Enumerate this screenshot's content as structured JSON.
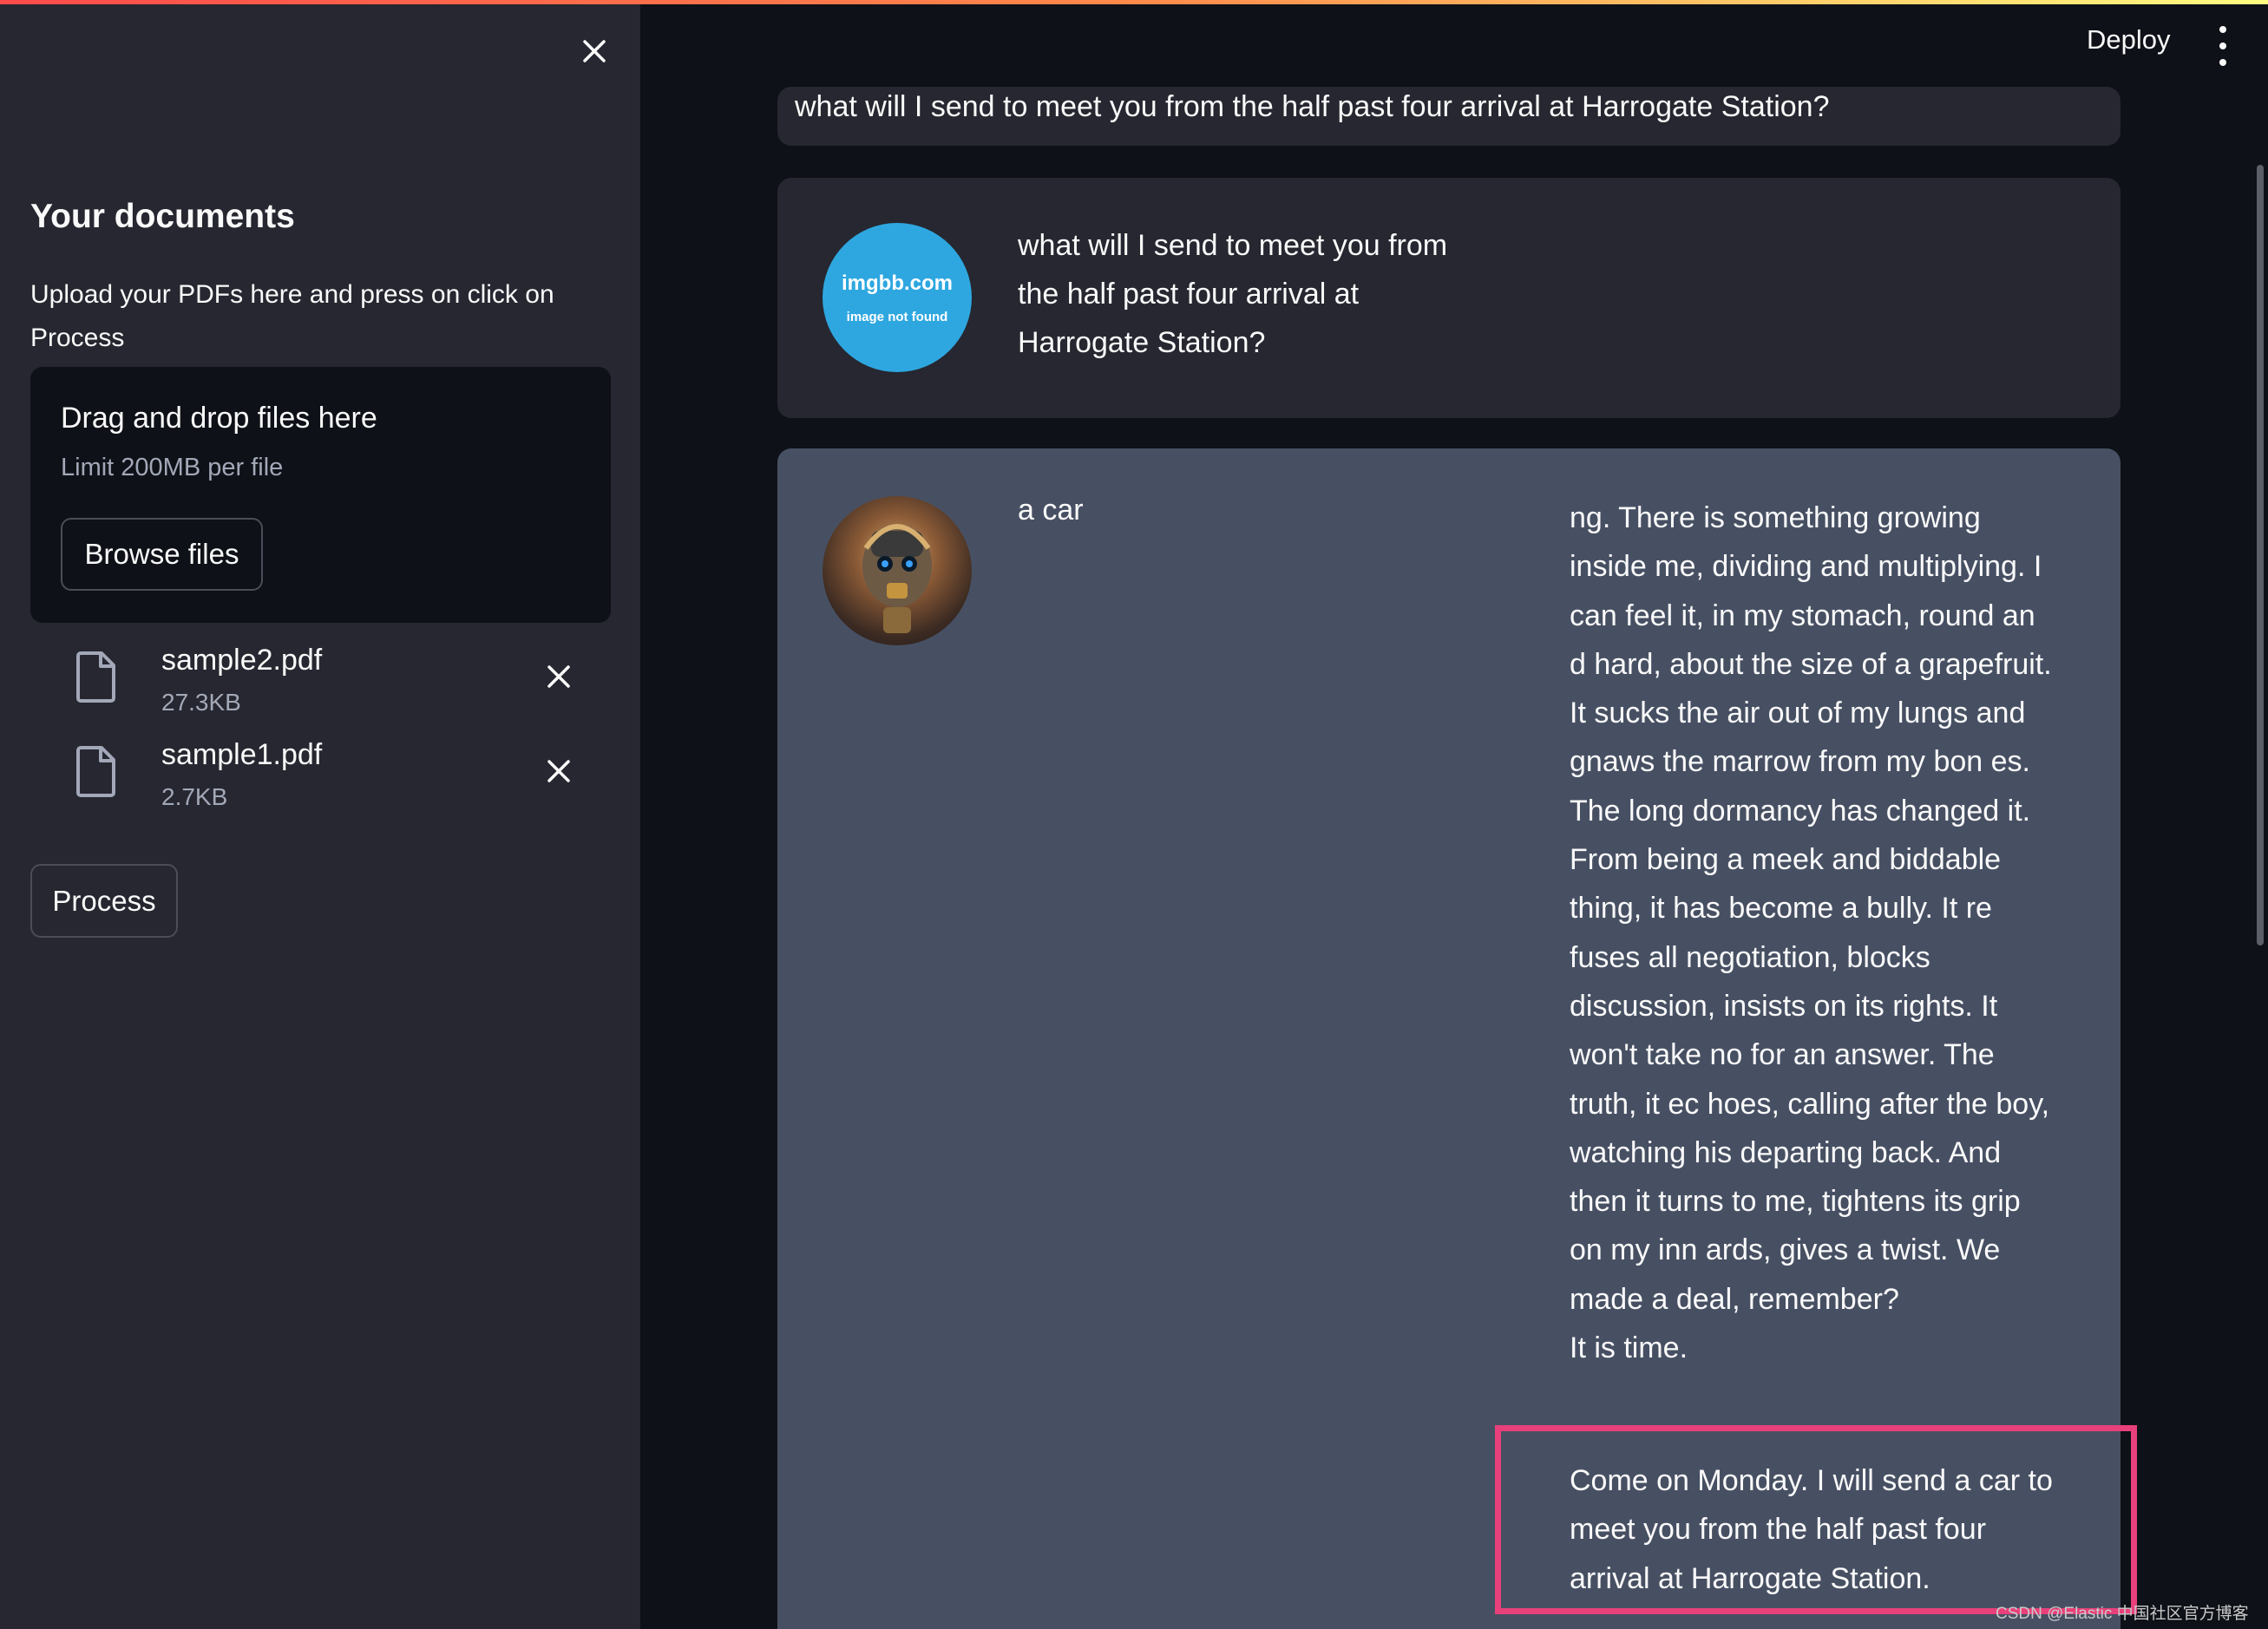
{
  "sidebar": {
    "title": "Your documents",
    "description": "Upload your PDFs here and press on click on Process",
    "uploader": {
      "title": "Drag and drop files here",
      "limit": "Limit 200MB per file",
      "browse_label": "Browse files"
    },
    "files": [
      {
        "name": "sample2.pdf",
        "size": "27.3KB"
      },
      {
        "name": "sample1.pdf",
        "size": "2.7KB"
      }
    ],
    "process_label": "Process"
  },
  "header": {
    "deploy_label": "Deploy"
  },
  "chat": {
    "top_message": "what will I send to meet you from the half past four arrival at Harrogate Station?",
    "user_message": "what will I send to meet you from the half past four arrival at Harrogate Station?",
    "user_avatar": {
      "line1": "imgbb.com",
      "line2": "image not found"
    },
    "bot_left": "a car",
    "bot_right": "ng. There is something growing inside me, dividing and multiplying. I can feel it, in my stomach, round an d hard, about the size of a grapefruit. It sucks the air out of my lungs and gnaws the marrow from my bon es. The long dormancy has changed it. From being a meek and biddable thing, it has become a bully. It re fuses all negotiation, blocks discussion, insists on its rights. It won't take no for an answer. The truth, it ec hoes, calling after the boy, watching his departing back. And then it turns to me, tightens its grip on my inn ards, gives a twist. We made a deal, remember?",
    "bot_right_tail": "It is time.",
    "bot_highlight": "Come on Monday. I will send a car to meet you from the half past four arrival at Harrogate Station."
  },
  "watermark": "CSDN @Elastic 中国社区官方博客",
  "colors": {
    "sidebar_bg": "#262730",
    "main_bg": "#0e1117",
    "bot_bubble": "#475063",
    "highlight": "#e8407a",
    "avatar_blue": "#2ea7e0"
  }
}
